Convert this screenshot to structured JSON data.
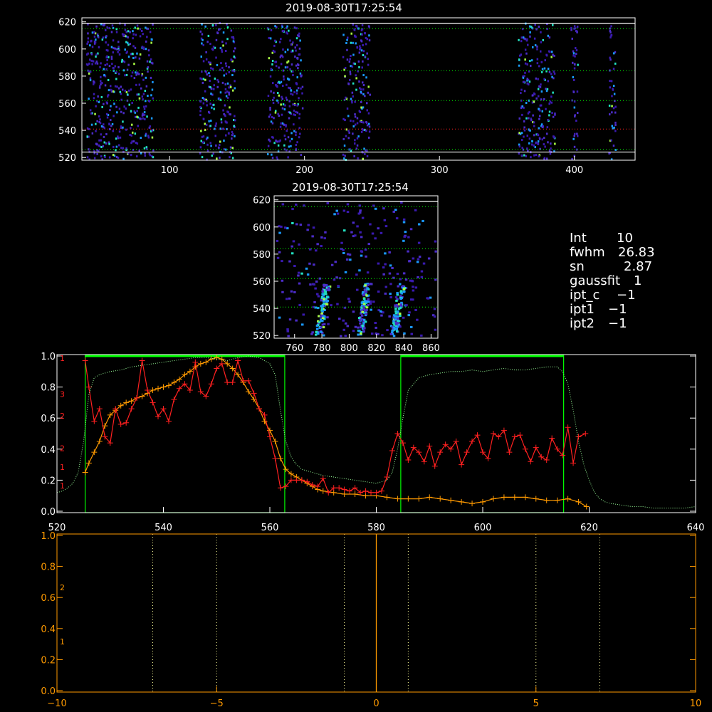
{
  "colors": {
    "background": "#000000",
    "axis": "#ffffff",
    "orange": "#ff9a00",
    "red": "#ff2020",
    "green": "#00ff00",
    "dotted_green": "#9aff9a",
    "dotted_yellow": "#ffff99",
    "heat_low": "#3a1ab0",
    "heat_mid": "#1a9aff",
    "heat_high": "#aaff44"
  },
  "info_panel": {
    "lines": [
      {
        "key": "Int",
        "value": "10"
      },
      {
        "key": "fwhm",
        "value": "26.83"
      },
      {
        "key": "sn",
        "value": "2.87"
      },
      {
        "key": "gaussfit",
        "value": "1"
      },
      {
        "key": "ipt_c",
        "value": "−1"
      },
      {
        "key": "ipt1",
        "value": "−1"
      },
      {
        "key": "ipt2",
        "value": "−1"
      }
    ]
  },
  "chart_data": [
    {
      "id": "top_spectrogram",
      "type": "heatmap",
      "title": "2019-08-30T17:25:54",
      "xlim": [
        35,
        445
      ],
      "ylim": [
        518,
        623
      ],
      "xticks": [
        100,
        200,
        300,
        400
      ],
      "yticks": [
        520,
        540,
        560,
        580,
        600,
        620
      ],
      "column_bands": [
        [
          38,
          88
        ],
        [
          122,
          148
        ],
        [
          172,
          198
        ],
        [
          228,
          248
        ],
        [
          358,
          385
        ],
        [
          397,
          402
        ],
        [
          425,
          430
        ]
      ],
      "hlines_solid": [
        619,
        524
      ],
      "hlines_dotted": [
        {
          "y": 615,
          "color": "green"
        },
        {
          "y": 584,
          "color": "green"
        },
        {
          "y": 562,
          "color": "green"
        },
        {
          "y": 541,
          "color": "red"
        },
        {
          "y": 526,
          "color": "green"
        }
      ]
    },
    {
      "id": "zoom_spectrogram",
      "type": "heatmap",
      "title": "2019-08-30T17:25:54",
      "xlim": [
        745,
        865
      ],
      "ylim": [
        518,
        623
      ],
      "xticks": [
        760,
        780,
        800,
        820,
        840,
        860
      ],
      "yticks": [
        520,
        540,
        560,
        580,
        600,
        620
      ],
      "streaks": [
        780,
        810,
        835
      ],
      "hlines_solid": [
        619
      ],
      "hlines_dotted": [
        {
          "y": 615,
          "color": "green"
        },
        {
          "y": 584,
          "color": "green"
        },
        {
          "y": 562,
          "color": "green"
        },
        {
          "y": 541,
          "color": "green"
        }
      ]
    },
    {
      "id": "spectrum_plot",
      "type": "line",
      "xlim": [
        520,
        640
      ],
      "ylim": [
        0,
        1
      ],
      "xticks": [
        520,
        540,
        560,
        580,
        600,
        620,
        640
      ],
      "yticks": [
        0.0,
        0.2,
        0.4,
        0.6,
        0.8,
        1.0
      ],
      "right_axis_ticks": [
        "1",
        "1",
        "2",
        "2",
        "3",
        "1"
      ],
      "windows": [
        [
          525.3,
          562.8
        ],
        [
          584.6,
          615.2
        ]
      ],
      "series": [
        {
          "color": "orange",
          "x": [
            525.3,
            526,
            527,
            528,
            529,
            530,
            531,
            532,
            533,
            534,
            535,
            536,
            537,
            538,
            539,
            540,
            541,
            542,
            543,
            544,
            545,
            546,
            547,
            548,
            549,
            550,
            551,
            552,
            553,
            554,
            555,
            556,
            557,
            558,
            559,
            560,
            561,
            562,
            563,
            564,
            565,
            566,
            567,
            568,
            569,
            570,
            572,
            574,
            576,
            578,
            580,
            582,
            584,
            586,
            588,
            590,
            592,
            594,
            596,
            598,
            600,
            602,
            604,
            606,
            608,
            610,
            612,
            614,
            616,
            618,
            619.5
          ],
          "y": [
            0.25,
            0.31,
            0.38,
            0.45,
            0.55,
            0.62,
            0.65,
            0.68,
            0.7,
            0.71,
            0.73,
            0.74,
            0.76,
            0.78,
            0.79,
            0.8,
            0.81,
            0.83,
            0.85,
            0.88,
            0.9,
            0.93,
            0.95,
            0.96,
            0.98,
            0.99,
            0.98,
            0.95,
            0.92,
            0.88,
            0.83,
            0.77,
            0.72,
            0.66,
            0.58,
            0.52,
            0.45,
            0.34,
            0.27,
            0.24,
            0.22,
            0.2,
            0.18,
            0.16,
            0.14,
            0.13,
            0.12,
            0.11,
            0.11,
            0.1,
            0.1,
            0.09,
            0.08,
            0.08,
            0.08,
            0.09,
            0.08,
            0.07,
            0.06,
            0.05,
            0.06,
            0.08,
            0.09,
            0.09,
            0.09,
            0.08,
            0.07,
            0.07,
            0.08,
            0.06,
            0.03
          ]
        },
        {
          "color": "red",
          "x": [
            525.3,
            526,
            527,
            528,
            529,
            530,
            531,
            532,
            533,
            534,
            535,
            536,
            537,
            538,
            539,
            540,
            541,
            542,
            543,
            544,
            545,
            546,
            547,
            548,
            549,
            550,
            551,
            552,
            553,
            554,
            555,
            556,
            557,
            558,
            559,
            560,
            561,
            562,
            563,
            564,
            565,
            566,
            567,
            568,
            569,
            570,
            571,
            572,
            573,
            574,
            575,
            576,
            577,
            578,
            579,
            580,
            581,
            582,
            583,
            584,
            585,
            586,
            587,
            588,
            589,
            590,
            591,
            592,
            593,
            594,
            595,
            596,
            597,
            598,
            599,
            600,
            601,
            602,
            603,
            604,
            605,
            606,
            607,
            608,
            609,
            610,
            611,
            612,
            613,
            614,
            615,
            616,
            617,
            618,
            619.3
          ],
          "y": [
            0.97,
            0.8,
            0.58,
            0.66,
            0.48,
            0.44,
            0.66,
            0.56,
            0.57,
            0.66,
            0.73,
            0.97,
            0.78,
            0.7,
            0.61,
            0.66,
            0.58,
            0.72,
            0.79,
            0.82,
            0.78,
            0.96,
            0.77,
            0.74,
            0.82,
            0.92,
            0.95,
            0.83,
            0.83,
            0.97,
            0.84,
            0.84,
            0.76,
            0.66,
            0.62,
            0.48,
            0.34,
            0.15,
            0.16,
            0.2,
            0.2,
            0.2,
            0.19,
            0.17,
            0.16,
            0.21,
            0.12,
            0.15,
            0.15,
            0.14,
            0.13,
            0.15,
            0.12,
            0.13,
            0.12,
            0.12,
            0.13,
            0.22,
            0.39,
            0.5,
            0.44,
            0.33,
            0.41,
            0.38,
            0.32,
            0.42,
            0.29,
            0.38,
            0.43,
            0.4,
            0.45,
            0.3,
            0.38,
            0.45,
            0.49,
            0.38,
            0.34,
            0.5,
            0.48,
            0.52,
            0.38,
            0.48,
            0.49,
            0.4,
            0.32,
            0.41,
            0.35,
            0.33,
            0.47,
            0.4,
            0.36,
            0.54,
            0.31,
            0.48,
            0.5
          ]
        },
        {
          "color": "dotted_green",
          "x": [
            520,
            521,
            522,
            523,
            524,
            525,
            526,
            527,
            528,
            530,
            532,
            534,
            536,
            538,
            540,
            542,
            544,
            546,
            548,
            550,
            552,
            554,
            556,
            558,
            560,
            561,
            562,
            563,
            564,
            565,
            566,
            568,
            570,
            572,
            574,
            576,
            578,
            580,
            582,
            583,
            584,
            585,
            586,
            588,
            590,
            592,
            594,
            596,
            598,
            600,
            602,
            604,
            606,
            608,
            610,
            612,
            614,
            615,
            616,
            617,
            618,
            619,
            620,
            621,
            622,
            623,
            624,
            626,
            628,
            630,
            632,
            634,
            636,
            638,
            640
          ],
          "y": [
            0.12,
            0.13,
            0.15,
            0.18,
            0.25,
            0.45,
            0.75,
            0.86,
            0.88,
            0.9,
            0.91,
            0.93,
            0.94,
            0.95,
            0.96,
            0.97,
            0.98,
            0.99,
            0.99,
            0.98,
            0.97,
            0.99,
            1.0,
            0.99,
            0.95,
            0.88,
            0.65,
            0.45,
            0.35,
            0.3,
            0.27,
            0.25,
            0.23,
            0.22,
            0.21,
            0.2,
            0.19,
            0.18,
            0.2,
            0.25,
            0.4,
            0.6,
            0.78,
            0.86,
            0.88,
            0.89,
            0.9,
            0.9,
            0.91,
            0.9,
            0.91,
            0.92,
            0.91,
            0.91,
            0.92,
            0.93,
            0.93,
            0.9,
            0.82,
            0.65,
            0.45,
            0.3,
            0.2,
            0.12,
            0.08,
            0.06,
            0.05,
            0.04,
            0.03,
            0.03,
            0.02,
            0.02,
            0.02,
            0.02,
            0.03
          ]
        }
      ],
      "markers": [
        "+"
      ]
    },
    {
      "id": "bottom_plot",
      "type": "line",
      "xlim": [
        -10,
        10
      ],
      "ylim": [
        0,
        1
      ],
      "xticks": [
        -10,
        -5,
        0,
        5,
        10
      ],
      "yticks": [
        0.0,
        0.2,
        0.4,
        0.6,
        0.8,
        1.0
      ],
      "right_axis_ticks": [
        "1",
        "2"
      ],
      "vline_solid": 0,
      "vlines_dotted": [
        -7,
        -5,
        -1,
        1,
        5,
        7
      ]
    }
  ]
}
